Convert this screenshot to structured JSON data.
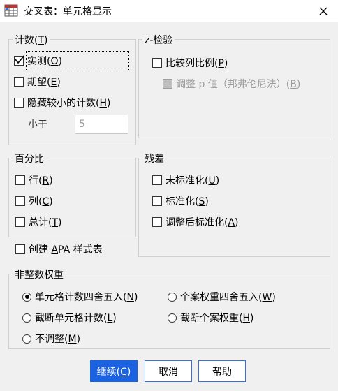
{
  "window": {
    "title": "交叉表：单元格显示"
  },
  "counts": {
    "legend": "计数(T)",
    "observed": {
      "label": "实测",
      "key": "O",
      "checked": true
    },
    "expected": {
      "label": "期望",
      "key": "E",
      "checked": false
    },
    "hide_small": {
      "label": "隐藏较小的计数",
      "key": "H",
      "checked": false
    },
    "less_than_label": "小于",
    "less_than_value": "5"
  },
  "ztest": {
    "legend": "z-检验",
    "compare": {
      "label": "比较列比例",
      "key": "P",
      "checked": false
    },
    "adjust": {
      "label": "调整 p 值（邦弗伦尼法）",
      "key": "B",
      "checked": false,
      "disabled": true
    }
  },
  "percentages": {
    "legend": "百分比",
    "row": {
      "label": "行",
      "key": "R"
    },
    "column": {
      "label": "列",
      "key": "C"
    },
    "total": {
      "label": "总计",
      "key": "T"
    }
  },
  "apa": {
    "label_pre": "创建 ",
    "key": "A",
    "label_post": "PA 样式表"
  },
  "residuals": {
    "legend": "残差",
    "unstandardized": {
      "label": "未标准化",
      "key": "U"
    },
    "standardized": {
      "label": "标准化",
      "key": "S"
    },
    "adjusted": {
      "label": "调整后标准化",
      "key": "A"
    }
  },
  "weights": {
    "legend": "非整数权重",
    "round_cell": {
      "label": "单元格计数四舍五入",
      "key": "N",
      "selected": true
    },
    "round_case": {
      "label": "个案权重四舍五入",
      "key": "W",
      "selected": false
    },
    "trunc_cell": {
      "label": "截断单元格计数",
      "key": "L",
      "selected": false
    },
    "trunc_case": {
      "label": "截断个案权重",
      "key": "H",
      "selected": false
    },
    "no_adjust": {
      "label": "不调整",
      "key": "M",
      "selected": false
    }
  },
  "buttons": {
    "continue": {
      "label": "继续",
      "key": "C"
    },
    "cancel": "取消",
    "help": "帮助"
  },
  "colors": {
    "primary": "#1a62e0",
    "border": "#cfcfcf",
    "background": "#f0f0f0"
  }
}
